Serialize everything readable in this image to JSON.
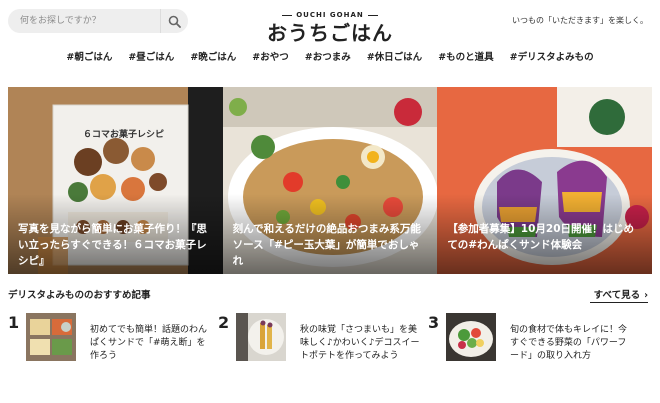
{
  "search": {
    "placeholder": "何をお探しですか？"
  },
  "logo": {
    "sub": "OUCHI GOHAN",
    "main": "おうちごはん"
  },
  "tagline": "いつもの「いただきます」を楽しく。",
  "nav": [
    "#朝ごはん",
    "#昼ごはん",
    "#晩ごはん",
    "#おやつ",
    "#おつまみ",
    "#休日ごはん",
    "#ものと道具",
    "#デリスタよみもの"
  ],
  "hero": [
    {
      "title": "写真を見ながら簡単にお菓子作り！『思い立ったらすぐできる！６コマお菓子レシピ』",
      "book_title": "６コマお菓子レシピ"
    },
    {
      "title": "刻んで和えるだけの絶品おつまみ系万能ソース「#ピー玉大葉」が簡単でおしゃれ"
    },
    {
      "title": "【参加者募集】10月20日開催！はじめての#わんぱくサンド体験会"
    }
  ],
  "section": {
    "title": "デリスタよみもののおすすめ記事",
    "see_all": "すべて見る"
  },
  "recommended": [
    {
      "num": "1",
      "text": "初めてでも簡単！話題のわんぱくサンドで「#萌え断」を作ろう"
    },
    {
      "num": "2",
      "text": "秋の味覚「さつまいも」を美味しく♪かわいく♪デコスイートポテトを作ってみよう"
    },
    {
      "num": "3",
      "text": "旬の食材で体もキレイに！今すぐできる野菜の「パワーフード」の取り入れ方"
    }
  ],
  "colors": {
    "text": "#222222",
    "search_bg": "#eeeeee",
    "accent": "#e4572e"
  },
  "icons": {
    "search": "search-icon",
    "see_all": "chevron-right-icon"
  }
}
